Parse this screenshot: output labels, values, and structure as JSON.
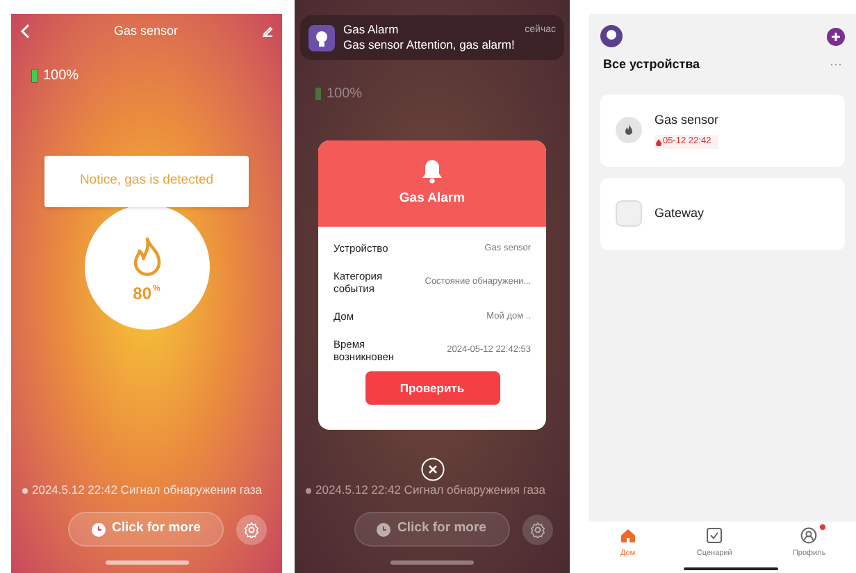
{
  "device_screen": {
    "title": "Gas sensor",
    "battery": "100%",
    "notice": "Notice, gas is detected",
    "reading": "80",
    "unit": "%",
    "log": "2024.5.12 22:42 Сигнал обнаружения газа",
    "more_button": "Click for more"
  },
  "alarm_screen": {
    "notification": {
      "title": "Gas Alarm",
      "message": "Gas sensor Attention, gas alarm!",
      "time": "сейчас"
    },
    "battery": "100%",
    "dialog": {
      "title": "Gas Alarm",
      "rows": [
        {
          "label": "Устройство",
          "value": "Gas sensor"
        },
        {
          "label": "Категория события",
          "value": "Состояние обнаружени..."
        },
        {
          "label": "Дом",
          "value": "Мой дом .."
        },
        {
          "label": "Время возникновен",
          "value": "2024-05-12 22:42:53"
        }
      ],
      "button": "Проверить"
    },
    "log": "2024.5.12 22:42 Сигнал обнаружения газа",
    "more_button": "Click for more"
  },
  "home_screen": {
    "heading": "Все устройства",
    "more": "···",
    "devices": [
      {
        "kind": "sensor",
        "name": "Gas sensor",
        "alert": "05-12 22:42"
      },
      {
        "kind": "gateway",
        "name": "Gateway"
      }
    ],
    "tabs": [
      {
        "kind": "home",
        "label": "Дом",
        "selected": true,
        "badge": false
      },
      {
        "kind": "scenes",
        "label": "Сценарий",
        "selected": false,
        "badge": false
      },
      {
        "kind": "profile",
        "label": "Профиль",
        "selected": false,
        "badge": true
      }
    ]
  }
}
